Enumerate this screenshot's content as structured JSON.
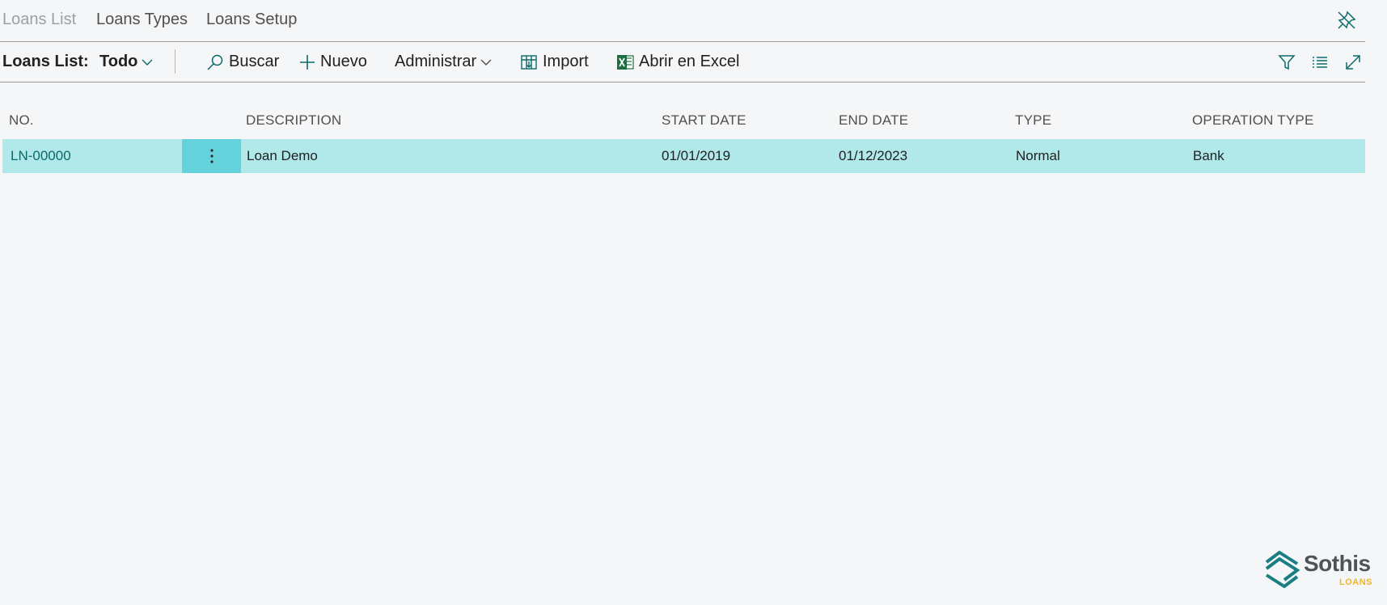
{
  "nav": {
    "items": [
      {
        "label": "Loans List",
        "active": true
      },
      {
        "label": "Loans Types",
        "active": false
      },
      {
        "label": "Loans Setup",
        "active": false
      }
    ]
  },
  "actionbar": {
    "page_caption": "Loans List:",
    "view_label": "Todo",
    "search_label": "Buscar",
    "new_label": "Nuevo",
    "manage_label": "Administrar",
    "import_label": "Import",
    "excel_label": "Abrir en Excel"
  },
  "table": {
    "columns": [
      "NO.",
      "DESCRIPTION",
      "START DATE",
      "END DATE",
      "TYPE",
      "OPERATION TYPE"
    ],
    "rows": [
      {
        "no": "LN-00000",
        "description": "Loan Demo",
        "start_date": "01/01/2019",
        "end_date": "01/12/2023",
        "type": "Normal",
        "operation_type": "Bank"
      }
    ]
  },
  "logo": {
    "name": "Sothis",
    "subtitle": "LOANS"
  },
  "icons": {
    "pin": "pin-icon",
    "search": "search-icon",
    "new": "plus-icon",
    "import": "import-icon",
    "excel": "excel-icon",
    "filter": "filter-icon",
    "list": "list-icon",
    "expand": "expand-icon",
    "row_menu": "more-vertical-icon"
  },
  "colors": {
    "accent": "#0b6a6a",
    "row_selected": "#b1e8ea",
    "row_menu": "#64d2da",
    "logo_accent": "#f0b429"
  }
}
